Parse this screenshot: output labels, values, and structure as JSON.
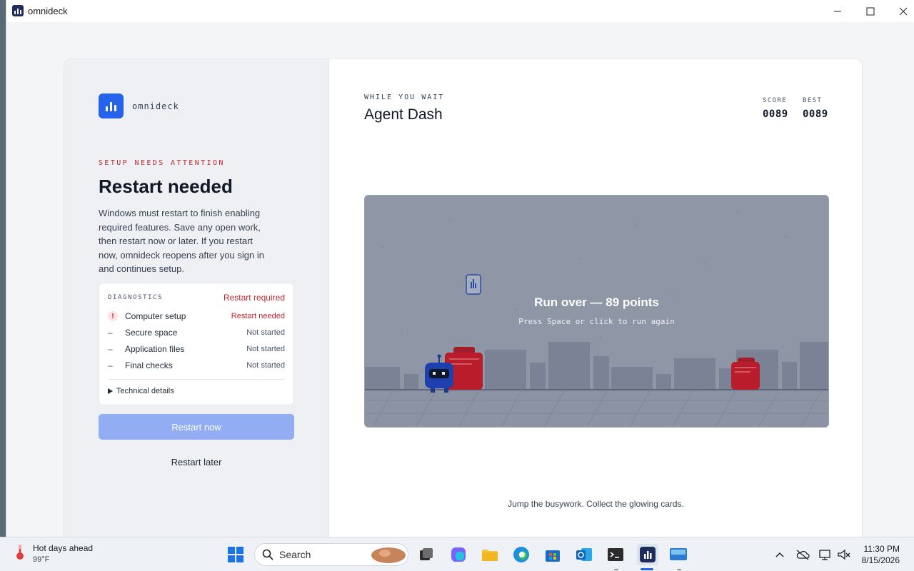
{
  "window": {
    "title": "omnideck"
  },
  "brand": {
    "name": "omnideck"
  },
  "setup": {
    "eyebrow": "SETUP NEEDS ATTENTION",
    "headline": "Restart needed",
    "description": "Windows must restart to finish enabling required features. Save any open work, then restart now or later. If you restart now, omnideck reopens after you sign in and continues setup."
  },
  "diagnostics": {
    "heading": "DIAGNOSTICS",
    "status": "Restart required",
    "rows": [
      {
        "label": "Computer setup",
        "value": "Restart needed",
        "mark": "!"
      },
      {
        "label": "Secure space",
        "value": "Not started",
        "mark": "–"
      },
      {
        "label": "Application files",
        "value": "Not started",
        "mark": "–"
      },
      {
        "label": "Final checks",
        "value": "Not started",
        "mark": "–"
      }
    ],
    "details_toggle": "Technical details"
  },
  "buttons": {
    "restart_now": "Restart now",
    "restart_later": "Restart later"
  },
  "game": {
    "eyebrow": "WHILE YOU WAIT",
    "title": "Agent Dash",
    "score_label": "SCORE",
    "score": "0089",
    "best_label": "BEST",
    "best": "0089",
    "overlay_title": "Run over — 89 points",
    "overlay_sub": "Press Space or click to run again",
    "tagline": "Jump the busywork. Collect the glowing cards."
  },
  "taskbar": {
    "weather_title": "Hot days ahead",
    "weather_temp": "99°F",
    "search_placeholder": "Search",
    "time": "11:30 PM",
    "date": "8/15/2026"
  },
  "colors": {
    "accent": "#2563eb",
    "danger": "#c0262d",
    "obstacle": "#b91c2a"
  }
}
